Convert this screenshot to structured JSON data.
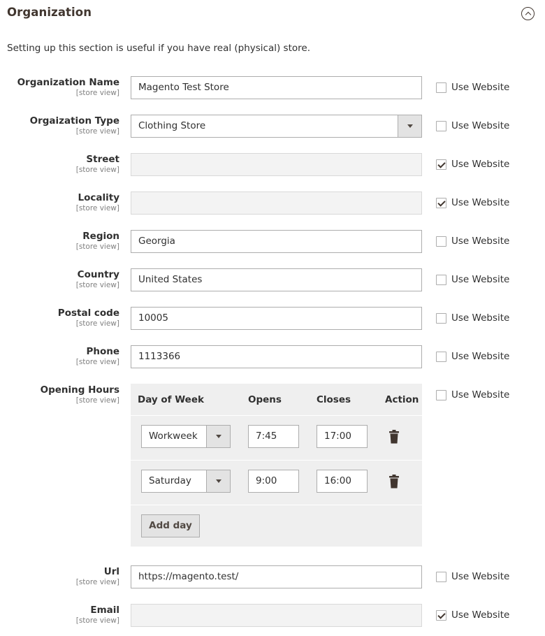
{
  "section": {
    "title": "Organization",
    "description": "Setting up this section is useful if you have real (physical) store.",
    "collapse_icon": "chevron-up-circle-icon"
  },
  "scope_label": "[store view]",
  "use_website_label": "Use Website",
  "fields": [
    {
      "label": "Organization Name",
      "value": "Magento Test Store",
      "type": "text",
      "disabled": false,
      "use_website": false
    },
    {
      "label": "Orgaization Type",
      "value": "Clothing Store",
      "type": "select",
      "disabled": false,
      "use_website": false
    },
    {
      "label": "Street",
      "value": "",
      "type": "text",
      "disabled": true,
      "use_website": true
    },
    {
      "label": "Locality",
      "value": "",
      "type": "text",
      "disabled": true,
      "use_website": true
    },
    {
      "label": "Region",
      "value": "Georgia",
      "type": "text",
      "disabled": false,
      "use_website": false
    },
    {
      "label": "Country",
      "value": "United States",
      "type": "text",
      "disabled": false,
      "use_website": false
    },
    {
      "label": "Postal code",
      "value": "10005",
      "type": "text",
      "disabled": false,
      "use_website": false
    },
    {
      "label": "Phone",
      "value": "1113366",
      "type": "text",
      "disabled": false,
      "use_website": false
    },
    {
      "label": "Url",
      "value": "https://magento.test/",
      "type": "text",
      "disabled": false,
      "use_website": false
    },
    {
      "label": "Email",
      "value": "",
      "type": "text",
      "disabled": true,
      "use_website": true
    }
  ],
  "opening_hours": {
    "label": "Opening Hours",
    "use_website": false,
    "columns": [
      "Day of Week",
      "Opens",
      "Closes",
      "Action"
    ],
    "rows": [
      {
        "day": "Workweek",
        "opens": "7:45",
        "closes": "17:00",
        "action_icon": "trash-icon"
      },
      {
        "day": "Saturday",
        "opens": "9:00",
        "closes": "16:00",
        "action_icon": "trash-icon"
      }
    ],
    "add_button": "Add day"
  }
}
